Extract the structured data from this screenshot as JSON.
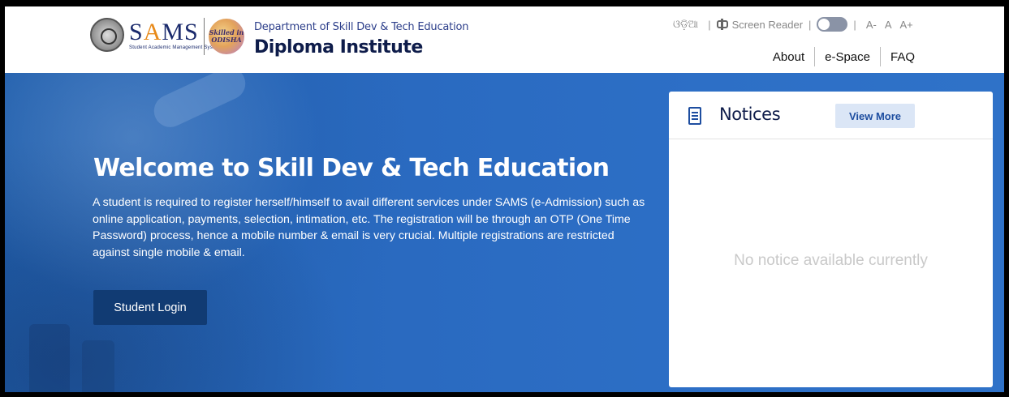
{
  "header": {
    "logo_text_prefix": "S",
    "logo_text_a": "A",
    "logo_text_suffix": "MS",
    "logo_subtext": "Student Academic Management System",
    "badge_line1": "Skilled in",
    "badge_line2": "ODISHA",
    "department": "Department of Skill Dev & Tech Education",
    "institute": "Diploma Institute"
  },
  "utility": {
    "language": "ଓଡ଼ିଆ",
    "screen_reader": "Screen Reader",
    "font_decrease": "A-",
    "font_normal": "A",
    "font_increase": "A+"
  },
  "nav": {
    "about": "About",
    "espace": "e-Space",
    "faq": "FAQ"
  },
  "hero": {
    "title": "Welcome to Skill Dev & Tech Education",
    "description": "A student is required to register herself/himself to avail different services under SAMS (e-Admission) such as online application, payments, selection, intimation, etc. The registration will be through an OTP (One Time Password) process, hence a mobile number & email is very crucial. Multiple registrations are restricted against single mobile & email.",
    "login_button": "Student Login"
  },
  "notices": {
    "title": "Notices",
    "view_more": "View More",
    "empty_message": "No notice available currently"
  }
}
